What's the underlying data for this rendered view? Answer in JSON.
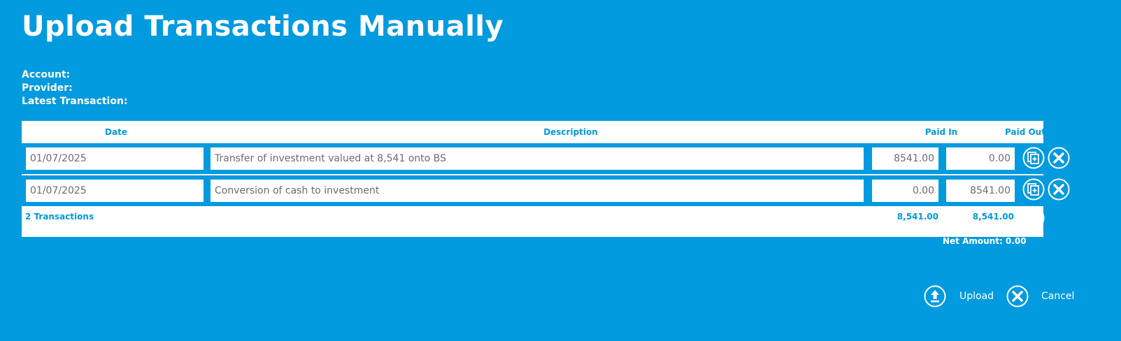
{
  "page": {
    "title": "Upload Transactions Manually"
  },
  "meta": {
    "account_label": "Account:",
    "provider_label": "Provider:",
    "latest_label": "Latest Transaction:"
  },
  "table": {
    "headers": {
      "date": "Date",
      "description": "Description",
      "paid_in": "Paid In",
      "paid_out": "Paid Out"
    },
    "rows": [
      {
        "date": "01/07/2025",
        "description": "Transfer of investment valued at 8,541 onto BS",
        "paid_in": "8541.00",
        "paid_out": "0.00"
      },
      {
        "date": "01/07/2025",
        "description": "Conversion of cash to investment",
        "paid_in": "0.00",
        "paid_out": "8541.00"
      }
    ],
    "footer": {
      "count": "2 Transactions",
      "paid_in_total": "8,541.00",
      "paid_out_total": "8,541.00"
    }
  },
  "net_amount": "Net Amount: 0.00",
  "actions": {
    "upload_label": "Upload",
    "cancel_label": "Cancel"
  },
  "icons": {
    "duplicate": "duplicate-row-icon",
    "delete": "delete-row-icon",
    "add": "add-row-icon",
    "upload": "upload-icon",
    "cancel": "cancel-icon"
  },
  "colors": {
    "background": "#009ADF",
    "panel": "#FFFFFF",
    "input_text": "#6D6D6D"
  }
}
